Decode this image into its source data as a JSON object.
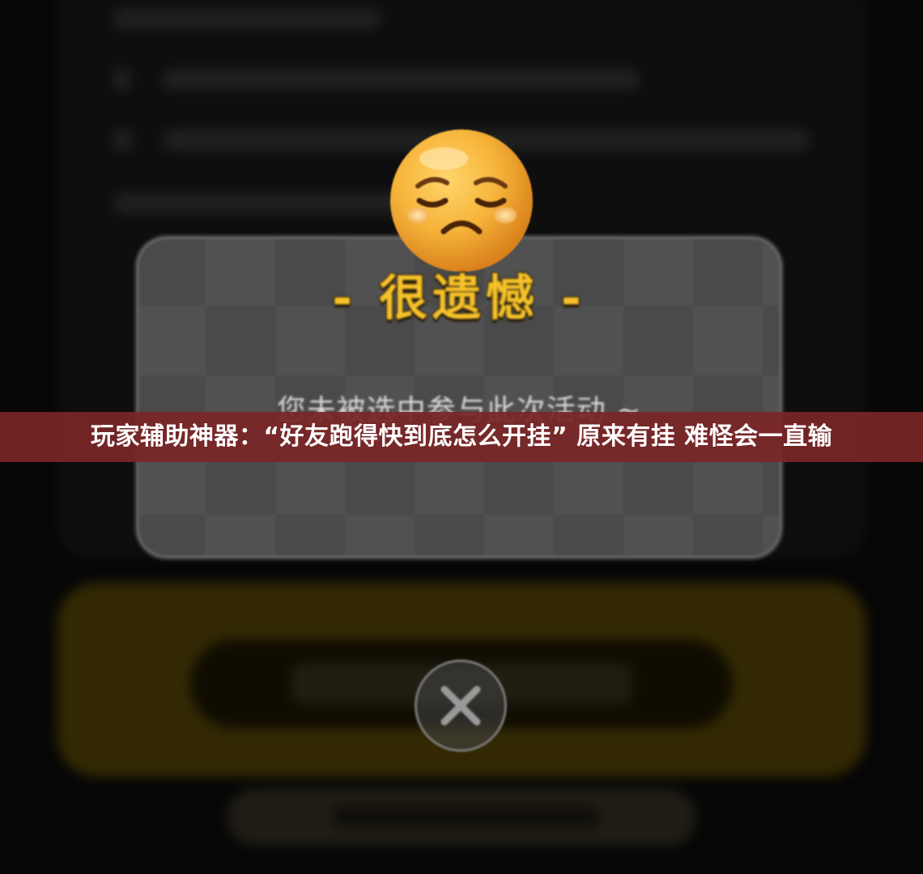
{
  "dialog": {
    "title": "- 很遗憾 -",
    "message": "您未被选中参与此次活动 ~"
  },
  "headline": {
    "text": "玩家辅助神器：“好友跑得快到底怎么开挂” 原来有挂 难怪会一直输"
  },
  "icons": {
    "emoji": "sad-face-icon",
    "close": "close-icon"
  },
  "colors": {
    "title": "#f7c229",
    "banner": "#7b2526",
    "dialog_bg": "#4a4a4a",
    "bg_accent": "#5b4a06"
  }
}
